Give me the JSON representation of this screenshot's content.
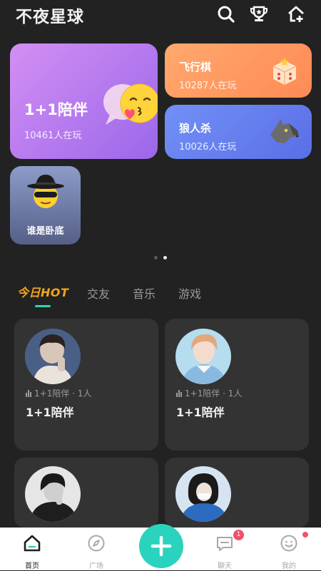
{
  "header": {
    "title": "不夜星球",
    "icons": [
      "search-icon",
      "trophy-icon",
      "home-plus-icon"
    ]
  },
  "banner_cards": [
    {
      "title": "1+1陪伴",
      "count": "10461人在玩",
      "colors": [
        "#c98af2",
        "#8f5fe8"
      ]
    },
    {
      "title": "飞行棋",
      "count": "10287人在玩",
      "colors": [
        "#ff9e62",
        "#ff8a52"
      ]
    },
    {
      "title": "狼人杀",
      "count": "10026人在玩",
      "colors": [
        "#6e8cf5",
        "#5b6fe8"
      ]
    },
    {
      "title": "谁是卧底",
      "colors": [
        "#7a8ec0",
        "#525e86"
      ]
    }
  ],
  "carousel": {
    "pages": 2,
    "active": 2
  },
  "tabs": {
    "active": "今日HOT",
    "items": [
      "今日HOT",
      "交友",
      "音乐",
      "游戏"
    ]
  },
  "rooms": [
    {
      "meta": "1+1陪伴 · 1人",
      "title": "1+1陪伴"
    },
    {
      "meta": "1+1陪伴 · 1人",
      "title": "1+1陪伴"
    },
    {
      "meta": "",
      "title": ""
    },
    {
      "meta": "",
      "title": ""
    }
  ],
  "bottom_nav": [
    {
      "label": "首页",
      "icon": "home-icon",
      "active": true
    },
    {
      "label": "广场",
      "icon": "compass-icon"
    },
    {
      "label": "",
      "icon": "plus-icon"
    },
    {
      "label": "聊天",
      "icon": "chat-icon",
      "badge": "1"
    },
    {
      "label": "我的",
      "icon": "smiley-icon",
      "dot": true
    }
  ],
  "colors": {
    "background": "#222222",
    "accent": "#2ad3bd",
    "hot": "#f2a51b",
    "badge": "#f0506e"
  }
}
